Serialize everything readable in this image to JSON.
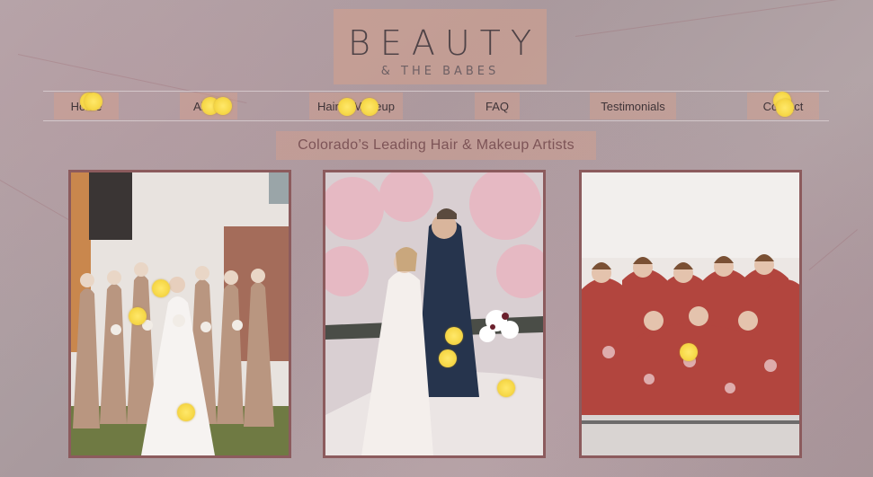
{
  "logo": {
    "title": "BEAUTY",
    "subtitle": "& THE BABES"
  },
  "nav": {
    "items": [
      {
        "label": "Home"
      },
      {
        "label": "About"
      },
      {
        "label": "Hair & Makeup"
      },
      {
        "label": "FAQ"
      },
      {
        "label": "Testimonials"
      },
      {
        "label": "Contact"
      }
    ]
  },
  "tagline": "Colorado’s Leading Hair & Makeup Artists",
  "gallery": [
    {
      "alt": "Bridal party in champagne dresses"
    },
    {
      "alt": "Bride and groom kissing under blossoms"
    },
    {
      "alt": "Bridesmaids in floral robes"
    }
  ],
  "colors": {
    "accent_peach": "#d6a08c",
    "frame": "#8c5b5d",
    "tagline_text": "#7d5457",
    "marker": "#f7d94a"
  }
}
